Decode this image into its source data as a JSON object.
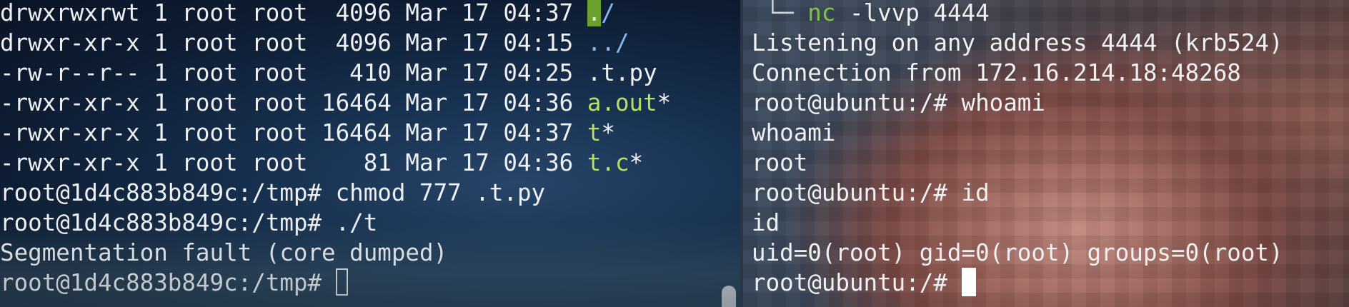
{
  "left_pane": {
    "lines": [
      {
        "meta": "drwxrwxrwt 1 root root  4096 Mar 17 04:37 ",
        "name": ".",
        "suffix": "/"
      },
      {
        "meta": "drwxr-xr-x 1 root root  4096 Mar 17 04:15 ",
        "name": "../",
        "suffix": ""
      },
      {
        "meta": "-rw-r--r-- 1 root root   410 Mar 17 04:25 ",
        "name": ".t.py",
        "suffix": ""
      },
      {
        "meta": "-rwxr-xr-x 1 root root 16464 Mar 17 04:36 ",
        "name": "a.out",
        "suffix": "*"
      },
      {
        "meta": "-rwxr-xr-x 1 root root 16464 Mar 17 04:37 ",
        "name": "t",
        "suffix": "*"
      },
      {
        "meta": "-rwxr-xr-x 1 root root    81 Mar 17 04:36 ",
        "name": "t.c",
        "suffix": "*"
      }
    ],
    "history": [
      {
        "prompt": "root@1d4c883b849c:/tmp# ",
        "command": "chmod 777 .t.py"
      },
      {
        "prompt": "root@1d4c883b849c:/tmp# ",
        "command": "./t"
      },
      {
        "output": "Segmentation fault (core dumped)"
      }
    ],
    "current_prompt": "root@1d4c883b849c:/tmp# "
  },
  "right_pane": {
    "tree_prefix": " └─ ",
    "listener_cmd": "nc",
    "listener_args": " -lvvp 4444",
    "output_lines": [
      "Listening on any address 4444 (krb524)",
      "Connection from 172.16.214.18:48268"
    ],
    "history": [
      {
        "prompt": "root@ubuntu:/# ",
        "command": "whoami"
      },
      {
        "output": "whoami"
      },
      {
        "output": "root"
      },
      {
        "prompt": "root@ubuntu:/# ",
        "command": "id"
      },
      {
        "output": "id"
      },
      {
        "output": "uid=0(root) gid=0(root) groups=0(root)"
      }
    ],
    "current_prompt": "root@ubuntu:/# "
  },
  "colors": {
    "directory": "#88b6ea",
    "executable": "#b6df62",
    "highlight": "#6aa12c",
    "command": "#7ec248"
  }
}
